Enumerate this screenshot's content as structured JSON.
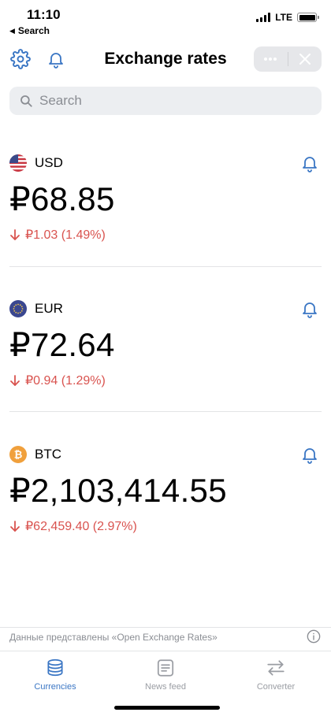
{
  "status": {
    "time": "11:10",
    "back_label": "Search",
    "network": "LTE"
  },
  "header": {
    "title": "Exchange rates",
    "settings_icon": "gear-icon",
    "notifications_icon": "bell-icon",
    "more_icon": "ellipsis-icon",
    "close_icon": "close-icon"
  },
  "search": {
    "placeholder": "Search",
    "value": ""
  },
  "rates": [
    {
      "code": "USD",
      "flag": "us-flag-icon",
      "value": "₽68.85",
      "change": "₽1.03 (1.49%)",
      "direction": "down"
    },
    {
      "code": "EUR",
      "flag": "eu-flag-icon",
      "value": "₽72.64",
      "change": "₽0.94 (1.29%)",
      "direction": "down"
    },
    {
      "code": "BTC",
      "flag": "bitcoin-icon",
      "value": "₽2,103,414.55",
      "change": "₽62,459.40 (2.97%)",
      "direction": "down"
    }
  ],
  "footer": {
    "note": "Данные представлены «Open Exchange Rates»"
  },
  "tabs": [
    {
      "label": "Currencies",
      "icon": "coins-stack-icon",
      "active": true
    },
    {
      "label": "News feed",
      "icon": "newspaper-icon",
      "active": false
    },
    {
      "label": "Converter",
      "icon": "swap-arrows-icon",
      "active": false
    }
  ],
  "colors": {
    "accent": "#3a76c4",
    "negative": "#d9534f",
    "inactive": "#9a9da3"
  }
}
